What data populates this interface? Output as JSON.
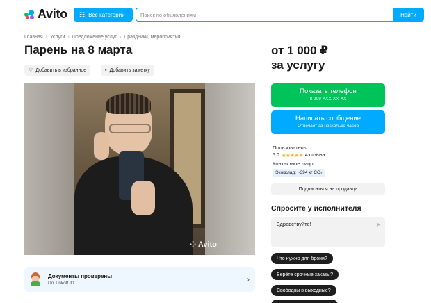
{
  "header": {
    "logo_text": "Avito",
    "categories_label": "Все категории",
    "search_placeholder": "Поиск по объявлениям",
    "search_button": "Найти",
    "brand_colors": {
      "blue": "#00aaff",
      "green": "#00c35a",
      "red": "#ff4053",
      "purple": "#965eeb"
    }
  },
  "breadcrumbs": [
    "Главная",
    "Услуги",
    "Предложение услуг",
    "Праздники, мероприятия"
  ],
  "listing": {
    "title": "Парень на 8 марта",
    "favorite_label": "Добавить в избранное",
    "note_label": "Добавить заметку",
    "photo_watermark": "Avito"
  },
  "documents": {
    "title": "Документы проверены",
    "subtitle": "По Tinkoff ID"
  },
  "sidebar": {
    "price_line1": "от 1 000 ₽",
    "price_line2": "за услугу",
    "show_phone": "Показать телефон",
    "phone_masked": "8 909 XXX-XX-XX",
    "write_message": "Написать сообщение",
    "response_time": "Отвечает за несколько часов",
    "seller_label": "Пользователь",
    "rating_value": "5.0",
    "stars": "★★★★★",
    "reviews": "4 отзыва",
    "contact_label": "Контактное лицо",
    "eco_badge": "Экокклад: ~394 кг CO₂",
    "subscribe": "Подписаться на продавца",
    "ask_title": "Спросите у исполнителя",
    "ask_input_value": "Здравствуйте!",
    "quick_questions": [
      "Что нужно для брони?",
      "Берёте срочные заказы?",
      "Свободны в выходные?"
    ]
  }
}
